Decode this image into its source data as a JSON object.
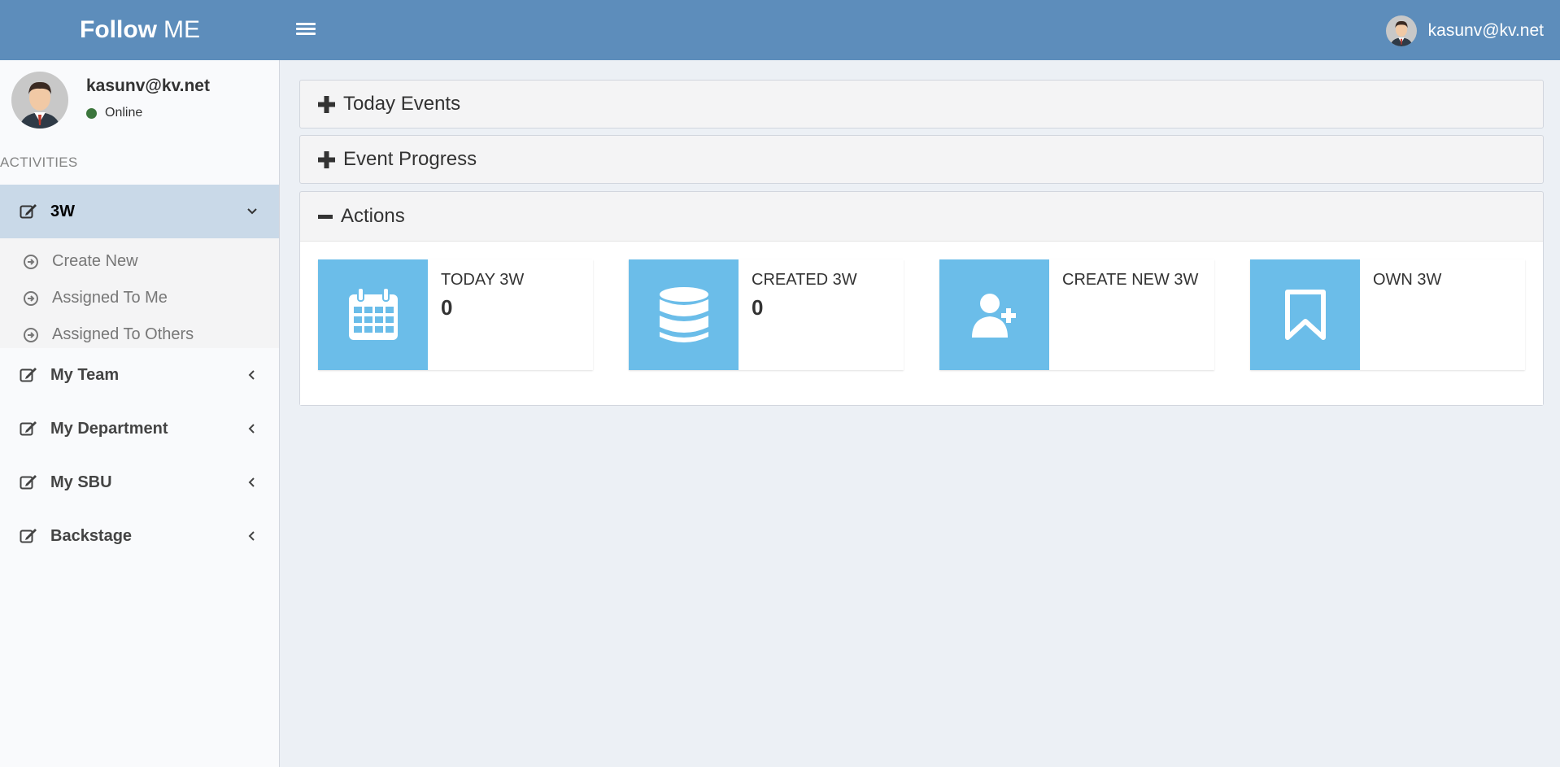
{
  "header": {
    "logo_bold": "Follow",
    "logo_light": "ME",
    "user_email": "kasunv@kv.net"
  },
  "sidebar": {
    "user_name": "kasunv@kv.net",
    "status": "Online",
    "section_label": "ACTIVITIES",
    "items": [
      {
        "label": "3W",
        "expanded": true,
        "sub": [
          "Create New",
          "Assigned To Me",
          "Assigned To Others"
        ]
      },
      {
        "label": "My Team"
      },
      {
        "label": "My Department"
      },
      {
        "label": "My SBU"
      },
      {
        "label": "Backstage"
      }
    ]
  },
  "main": {
    "panels": [
      {
        "title": "Today Events",
        "state": "collapsed"
      },
      {
        "title": "Event Progress",
        "state": "collapsed"
      },
      {
        "title": "Actions",
        "state": "expanded"
      }
    ],
    "info_boxes": [
      {
        "label": "TODAY 3W",
        "value": "0",
        "icon": "calendar-icon"
      },
      {
        "label": "CREATED 3W",
        "value": "0",
        "icon": "database-icon"
      },
      {
        "label": "CREATE NEW 3W",
        "value": "",
        "icon": "add-user-icon"
      },
      {
        "label": "OWN 3W",
        "value": "",
        "icon": "bookmark-icon"
      }
    ]
  },
  "colors": {
    "header": "#5d8dbb",
    "info_icon": "#6bbde9",
    "active_menu": "#c9d9e8",
    "status_dot": "#3c763d"
  }
}
